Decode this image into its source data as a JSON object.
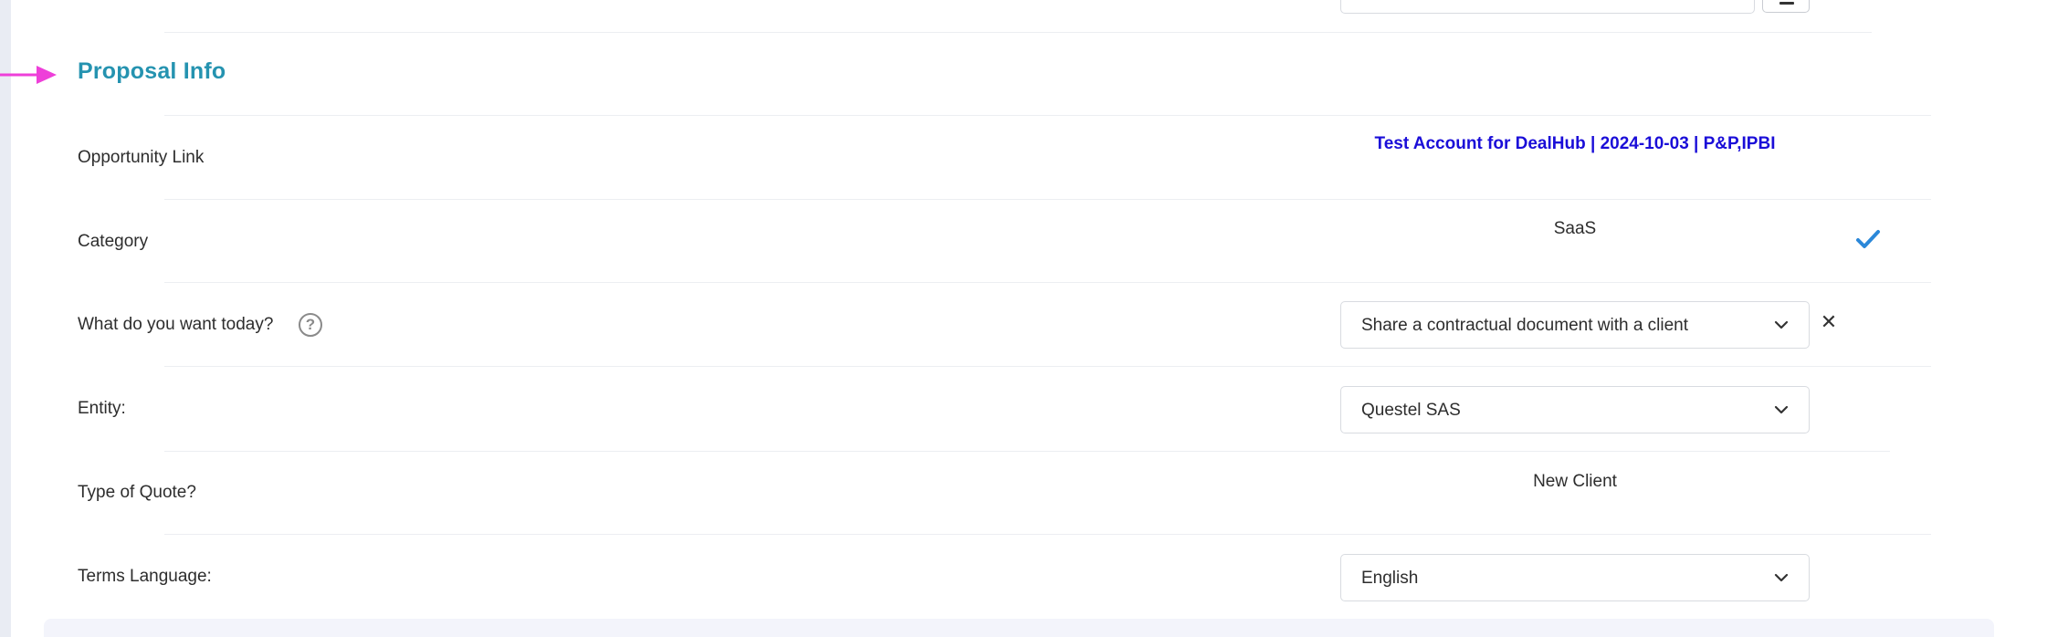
{
  "section": {
    "title": "Proposal Info"
  },
  "rows": {
    "opportunity": {
      "label": "Opportunity Link",
      "value": "Test Account for DealHub | 2024-10-03 | P&P,IPBI"
    },
    "category": {
      "label": "Category",
      "value": "SaaS",
      "icon": "check-icon"
    },
    "want_today": {
      "label": "What do you want today?",
      "help_icon": "?",
      "selected": "Share a contractual document with a client",
      "clear_icon": "✕"
    },
    "entity": {
      "label": "Entity:",
      "selected": "Questel SAS"
    },
    "quote_type": {
      "label": "Type of Quote?",
      "value": "New Client"
    },
    "terms_language": {
      "label": "Terms Language:",
      "selected": "English"
    }
  },
  "colors": {
    "accent": "#2593b0",
    "link": "#1a0dd8",
    "check": "#2b88d9",
    "arrow": "#ee3fd9"
  }
}
